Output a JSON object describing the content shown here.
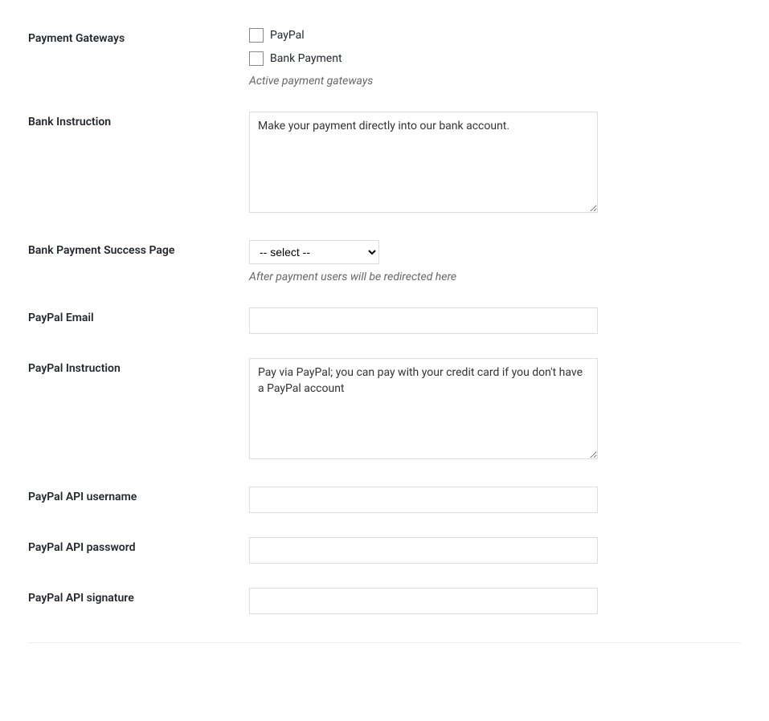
{
  "fields": {
    "payment_gateways": {
      "label": "Payment Gateways",
      "options": {
        "paypal": {
          "label": "PayPal",
          "checked": false
        },
        "bank": {
          "label": "Bank Payment",
          "checked": false
        }
      },
      "description": "Active payment gateways"
    },
    "bank_instruction": {
      "label": "Bank Instruction",
      "value": "Make your payment directly into our bank account."
    },
    "bank_success_page": {
      "label": "Bank Payment Success Page",
      "selected": "-- select --",
      "description": "After payment users will be redirected here"
    },
    "paypal_email": {
      "label": "PayPal Email",
      "value": ""
    },
    "paypal_instruction": {
      "label": "PayPal Instruction",
      "value": "Pay via PayPal; you can pay with your credit card if you don't have a PayPal account"
    },
    "paypal_api_username": {
      "label": "PayPal API username",
      "value": ""
    },
    "paypal_api_password": {
      "label": "PayPal API password",
      "value": ""
    },
    "paypal_api_signature": {
      "label": "PayPal API signature",
      "value": ""
    }
  }
}
